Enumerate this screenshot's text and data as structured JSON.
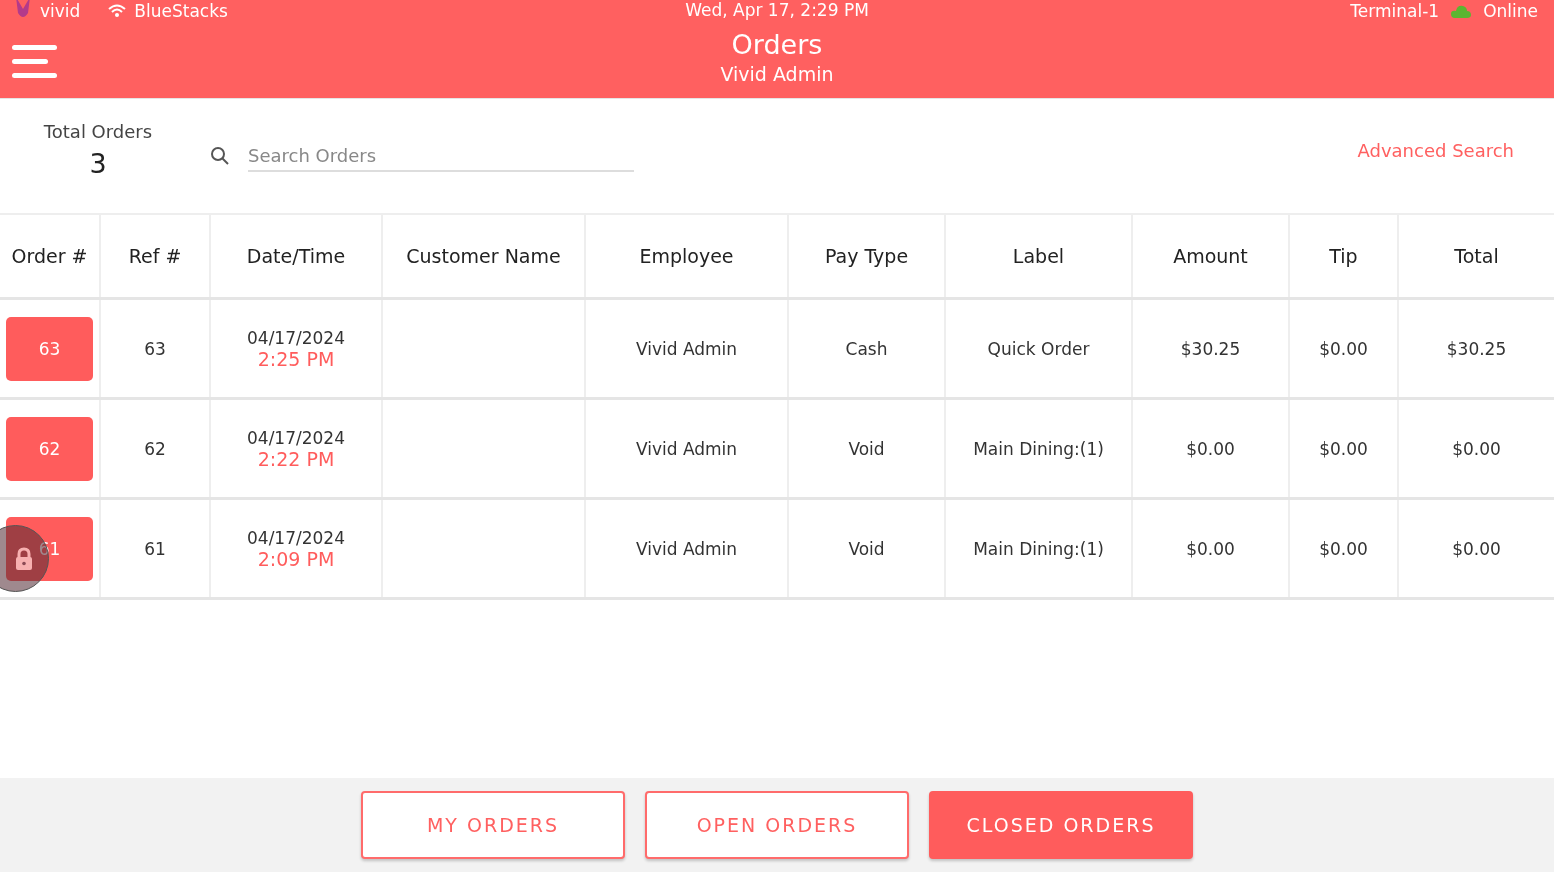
{
  "status_bar": {
    "brand": "vivid",
    "network": "BlueStacks",
    "datetime": "Wed, Apr 17, 2:29 PM",
    "terminal": "Terminal-1",
    "connection": "Online"
  },
  "header": {
    "title": "Orders",
    "subtitle": "Vivid Admin"
  },
  "summary": {
    "label": "Total Orders",
    "count": "3"
  },
  "search": {
    "placeholder": "Search Orders"
  },
  "advanced_search": "Advanced Search",
  "table": {
    "columns": [
      "Order #",
      "Ref #",
      "Date/Time",
      "Customer Name",
      "Employee",
      "Pay Type",
      "Label",
      "Amount",
      "Tip",
      "Total"
    ],
    "rows": [
      {
        "order": "63",
        "ref": "63",
        "date": "04/17/2024",
        "time": "2:25 PM",
        "customer": "",
        "employee": "Vivid Admin",
        "pay_type": "Cash",
        "label": "Quick Order",
        "amount": "$30.25",
        "tip": "$0.00",
        "total": "$30.25",
        "locked": false
      },
      {
        "order": "62",
        "ref": "62",
        "date": "04/17/2024",
        "time": "2:22 PM",
        "customer": "",
        "employee": "Vivid Admin",
        "pay_type": "Void",
        "label": "Main Dining:(1)",
        "amount": "$0.00",
        "tip": "$0.00",
        "total": "$0.00",
        "locked": false
      },
      {
        "order": "61",
        "ref": "61",
        "date": "04/17/2024",
        "time": "2:09 PM",
        "customer": "",
        "employee": "Vivid Admin",
        "pay_type": "Void",
        "label": "Main Dining:(1)",
        "amount": "$0.00",
        "tip": "$0.00",
        "total": "$0.00",
        "locked": true
      }
    ]
  },
  "tabs": [
    {
      "label": "MY ORDERS",
      "selected": false
    },
    {
      "label": "OPEN ORDERS",
      "selected": false
    },
    {
      "label": "CLOSED ORDERS",
      "selected": true
    }
  ]
}
